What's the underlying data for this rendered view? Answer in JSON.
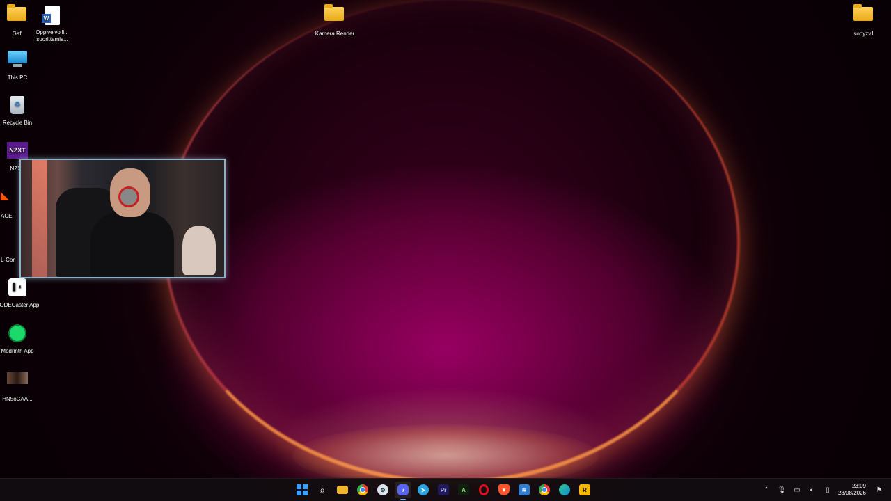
{
  "desktop": {
    "icons": [
      {
        "label": "Gafi",
        "icon": "folder-icon"
      },
      {
        "label": "Oppivelvolli... suorittamis...",
        "icon": "word-document-icon"
      },
      {
        "label": "Kamera Render",
        "icon": "folder-icon"
      },
      {
        "label": "sonyzv1",
        "icon": "folder-icon"
      },
      {
        "label": "This PC",
        "icon": "monitor-icon"
      },
      {
        "label": "Recycle Bin",
        "icon": "recycle-bin-icon"
      },
      {
        "label": "NZXT",
        "icon": "nzxt-icon"
      },
      {
        "label": "FACE",
        "icon": "faceit-icon"
      },
      {
        "label": "L-Cor",
        "icon": "l-connect-icon"
      },
      {
        "label": "RODECaster App",
        "icon": "rodecaster-icon"
      },
      {
        "label": "Modrinth App",
        "icon": "modrinth-icon"
      },
      {
        "label": "HN5oCAA...",
        "icon": "image-file-icon"
      }
    ],
    "nzxt_logo_text": "NZXT"
  },
  "taskbar": {
    "apps": [
      {
        "name": "start",
        "icon": "windows-start-icon",
        "color": "#3aa0ff"
      },
      {
        "name": "search",
        "icon": "search-icon",
        "color": "#ffffff"
      },
      {
        "name": "file-explorer",
        "icon": "folder-icon",
        "color": "#f2b530"
      },
      {
        "name": "chrome",
        "icon": "chrome-icon",
        "color": "#34a853"
      },
      {
        "name": "steam",
        "icon": "steam-icon",
        "color": "#1b2838"
      },
      {
        "name": "discord",
        "icon": "discord-icon",
        "color": "#5865f2"
      },
      {
        "name": "telegram",
        "icon": "telegram-icon",
        "color": "#2aa5e0"
      },
      {
        "name": "premiere-pro",
        "icon": "premiere-pro-icon",
        "color": "#1f1a5c",
        "text": "Pr"
      },
      {
        "name": "app-a",
        "icon": "a-app-icon",
        "color": "#1a2a1a",
        "text": "A"
      },
      {
        "name": "opera",
        "icon": "opera-icon",
        "color": "#e0101f"
      },
      {
        "name": "brave",
        "icon": "brave-icon",
        "color": "#fb542b"
      },
      {
        "name": "app-blue",
        "icon": "blue-app-icon",
        "color": "#2f7dd1"
      },
      {
        "name": "chrome-2",
        "icon": "chrome-icon",
        "color": "#ea4335"
      },
      {
        "name": "edge",
        "icon": "edge-icon",
        "color": "#0c8fd6"
      },
      {
        "name": "rockstar",
        "icon": "rockstar-icon",
        "color": "#f7b800",
        "text": "R"
      }
    ],
    "tray": {
      "time": "23:09",
      "date": "28/08/2026"
    }
  }
}
